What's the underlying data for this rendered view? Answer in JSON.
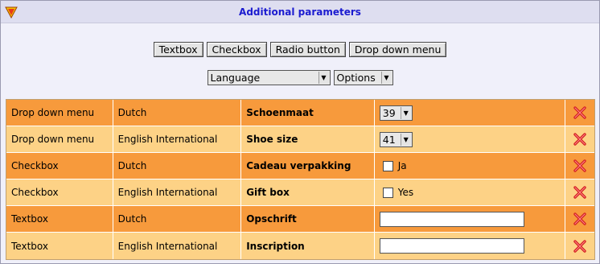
{
  "header": {
    "title": "Additional parameters",
    "icon": "collapse-arrow-icon"
  },
  "buttons": {
    "textbox": "Textbox",
    "checkbox": "Checkbox",
    "radio": "Radio button",
    "dropdown": "Drop down menu"
  },
  "filters": {
    "language": "Language",
    "options": "Options"
  },
  "rows": [
    {
      "type": "Drop down menu",
      "language": "Dutch",
      "name": "Schoenmaat",
      "control": "select",
      "value": "39"
    },
    {
      "type": "Drop down menu",
      "language": "English International",
      "name": "Shoe size",
      "control": "select",
      "value": "41"
    },
    {
      "type": "Checkbox",
      "language": "Dutch",
      "name": "Cadeau verpakking",
      "control": "checkbox",
      "value": "Ja"
    },
    {
      "type": "Checkbox",
      "language": "English International",
      "name": "Gift box",
      "control": "checkbox",
      "value": "Yes"
    },
    {
      "type": "Textbox",
      "language": "Dutch",
      "name": "Opschrift",
      "control": "text",
      "value": ""
    },
    {
      "type": "Textbox",
      "language": "English International",
      "name": "Inscription",
      "control": "text",
      "value": ""
    }
  ],
  "colors": {
    "row_dark": "#f79a3c",
    "row_light": "#fdd286",
    "title": "#1b1bd0",
    "delete": "#d42020"
  },
  "icons": {
    "delete": "delete-x-icon",
    "dropdown": "chevron-down-icon"
  }
}
